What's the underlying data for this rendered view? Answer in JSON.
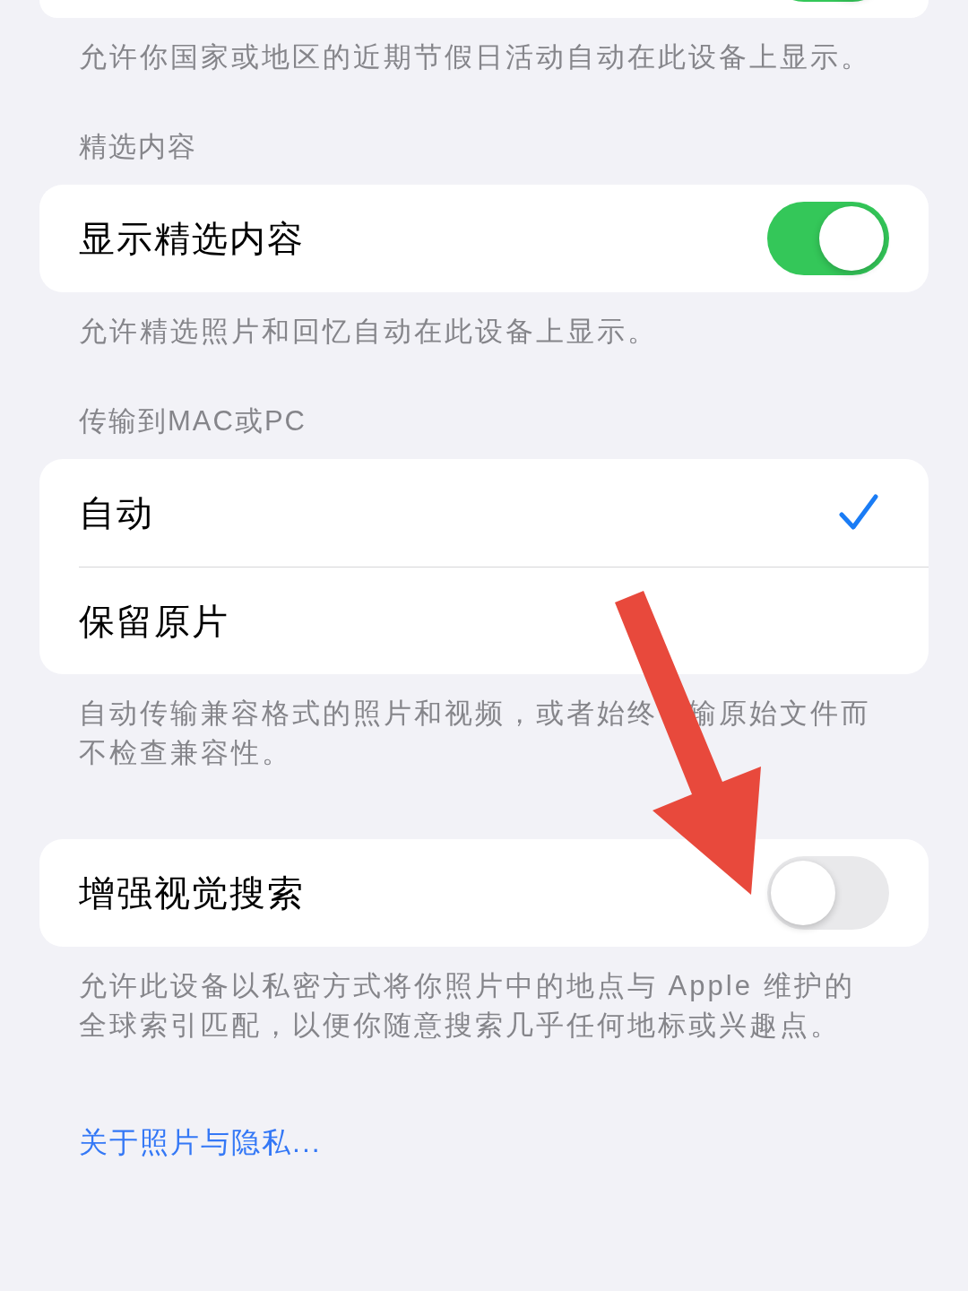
{
  "top_section": {
    "toggle_on": true,
    "footer": "允许你国家或地区的近期节假日活动自动在此设备上显示。"
  },
  "sections": [
    {
      "header": "精选内容",
      "rows": [
        {
          "kind": "toggle",
          "label": "显示精选内容",
          "on": true
        }
      ],
      "footer": [
        "允许精选照片和回忆自动在此设备上显示。"
      ]
    },
    {
      "header": "传输到MAC或PC",
      "rows": [
        {
          "kind": "choice",
          "label": "自动",
          "selected": true
        },
        {
          "kind": "choice",
          "label": "保留原片",
          "selected": false
        }
      ],
      "footer": [
        [
          "自动传输兼容格式的照片和视频，或者始终",
          "输原始文件而"
        ],
        "不检查兼容性。"
      ]
    },
    {
      "rows": [
        {
          "kind": "toggle",
          "label": "增强视觉搜索",
          "on": false
        }
      ],
      "footer": [
        "允许此设备以私密方式将你照片中的地点与 Apple 维护的",
        "全球索引匹配，以便你随意搜索几乎任何地标或兴趣点。"
      ]
    }
  ],
  "link": "关于照片与隐私..."
}
